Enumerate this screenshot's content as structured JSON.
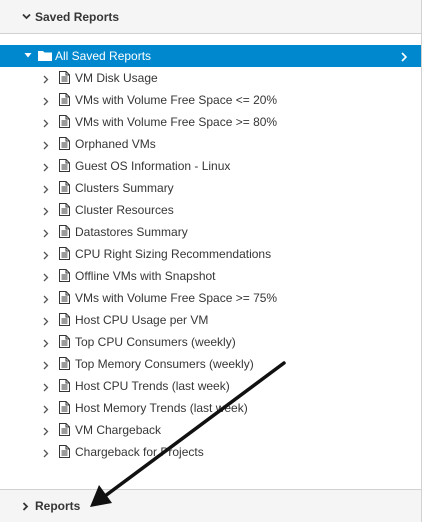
{
  "saved_reports_header": {
    "label": "Saved Reports",
    "icon": "chevron-down-icon"
  },
  "tree": {
    "root": {
      "label": "All Saved Reports",
      "icon": "folder-icon",
      "selected_color": "#0088ce"
    },
    "items": [
      {
        "label": "VM Disk Usage"
      },
      {
        "label": "VMs with Volume Free Space <= 20%"
      },
      {
        "label": "VMs with Volume Free Space >= 80%"
      },
      {
        "label": "Orphaned VMs"
      },
      {
        "label": "Guest OS Information - Linux"
      },
      {
        "label": "Clusters Summary"
      },
      {
        "label": "Cluster Resources"
      },
      {
        "label": "Datastores Summary"
      },
      {
        "label": "CPU Right Sizing Recommendations"
      },
      {
        "label": "Offline VMs with Snapshot"
      },
      {
        "label": "VMs with Volume Free Space >= 75%"
      },
      {
        "label": "Host CPU Usage per VM"
      },
      {
        "label": "Top CPU Consumers (weekly)"
      },
      {
        "label": "Top Memory Consumers (weekly)"
      },
      {
        "label": "Host CPU Trends (last week)"
      },
      {
        "label": "Host Memory Trends (last week)"
      },
      {
        "label": "VM Chargeback"
      },
      {
        "label": "Chargeback for Projects"
      }
    ]
  },
  "reports_header": {
    "label": "Reports",
    "icon": "chevron-right-icon"
  }
}
